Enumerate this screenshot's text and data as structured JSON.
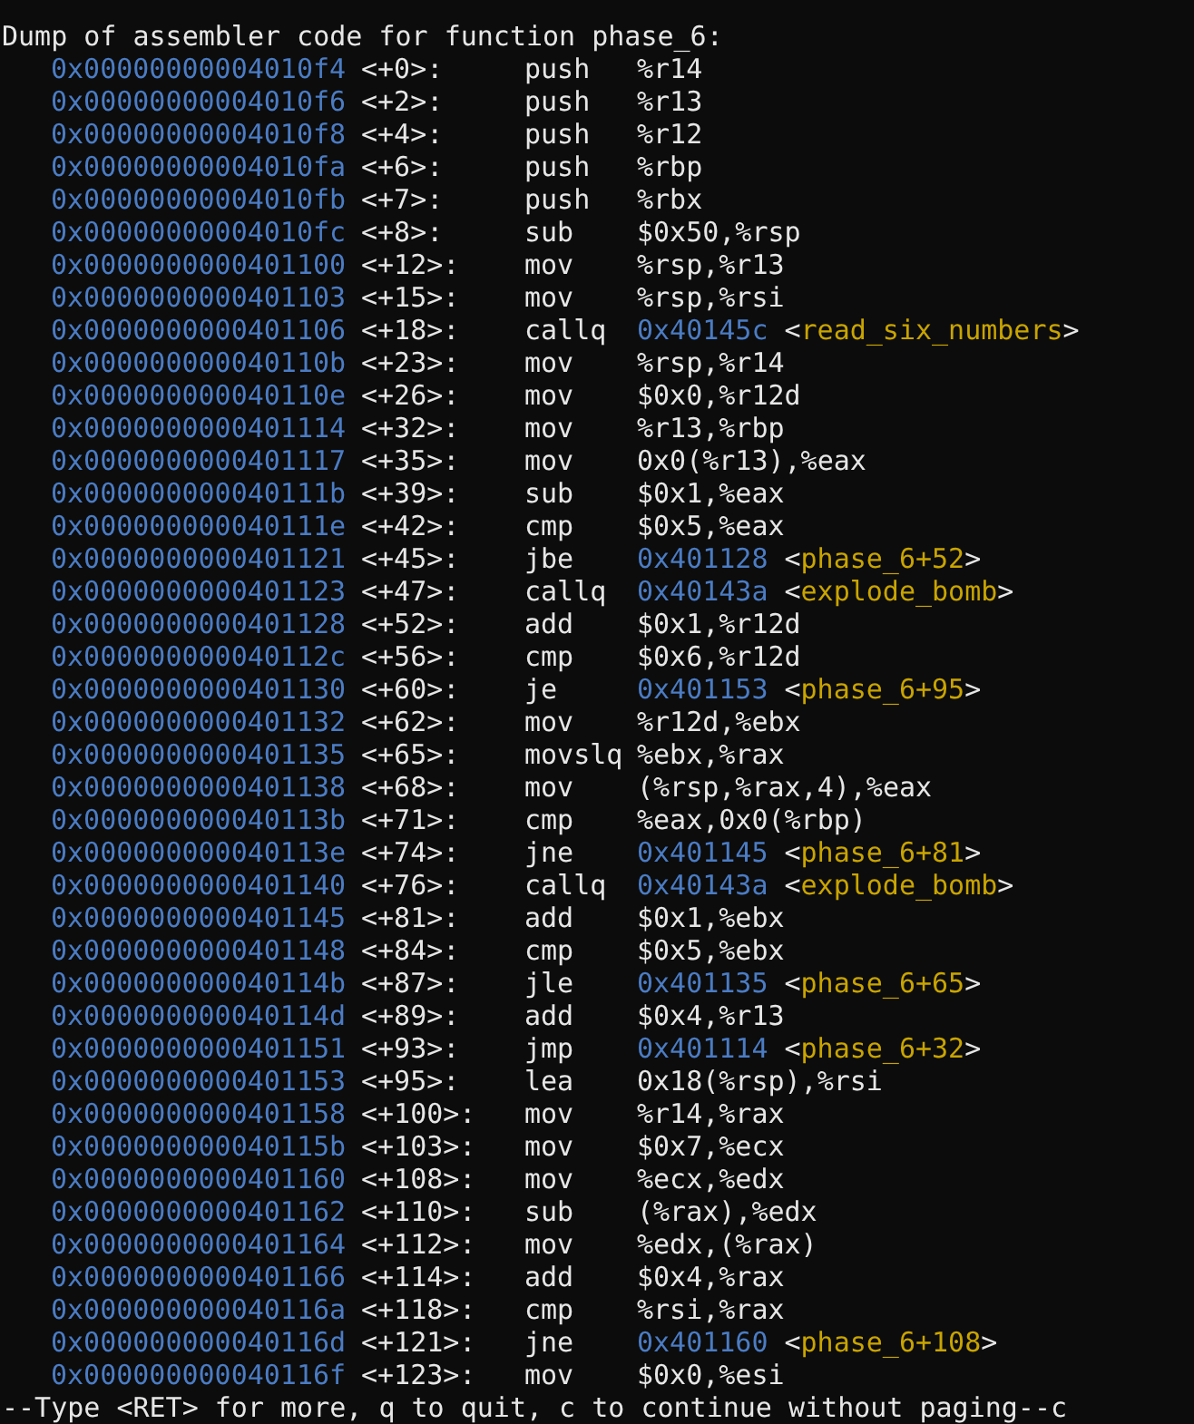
{
  "header": "Dump of assembler code for function phase_6:",
  "lines": [
    {
      "address": "0x00000000004010f4",
      "offset": "<+0>:",
      "mnemonic": "push",
      "operands": "%r14"
    },
    {
      "address": "0x00000000004010f6",
      "offset": "<+2>:",
      "mnemonic": "push",
      "operands": "%r13"
    },
    {
      "address": "0x00000000004010f8",
      "offset": "<+4>:",
      "mnemonic": "push",
      "operands": "%r12"
    },
    {
      "address": "0x00000000004010fa",
      "offset": "<+6>:",
      "mnemonic": "push",
      "operands": "%rbp"
    },
    {
      "address": "0x00000000004010fb",
      "offset": "<+7>:",
      "mnemonic": "push",
      "operands": "%rbx"
    },
    {
      "address": "0x00000000004010fc",
      "offset": "<+8>:",
      "mnemonic": "sub",
      "operands": "$0x50,%rsp"
    },
    {
      "address": "0x0000000000401100",
      "offset": "<+12>:",
      "mnemonic": "mov",
      "operands": "%rsp,%r13"
    },
    {
      "address": "0x0000000000401103",
      "offset": "<+15>:",
      "mnemonic": "mov",
      "operands": "%rsp,%rsi"
    },
    {
      "address": "0x0000000000401106",
      "offset": "<+18>:",
      "mnemonic": "callq",
      "target": "0x40145c",
      "symbol": "<read_six_numbers>"
    },
    {
      "address": "0x000000000040110b",
      "offset": "<+23>:",
      "mnemonic": "mov",
      "operands": "%rsp,%r14"
    },
    {
      "address": "0x000000000040110e",
      "offset": "<+26>:",
      "mnemonic": "mov",
      "operands": "$0x0,%r12d"
    },
    {
      "address": "0x0000000000401114",
      "offset": "<+32>:",
      "mnemonic": "mov",
      "operands": "%r13,%rbp"
    },
    {
      "address": "0x0000000000401117",
      "offset": "<+35>:",
      "mnemonic": "mov",
      "operands": "0x0(%r13),%eax"
    },
    {
      "address": "0x000000000040111b",
      "offset": "<+39>:",
      "mnemonic": "sub",
      "operands": "$0x1,%eax"
    },
    {
      "address": "0x000000000040111e",
      "offset": "<+42>:",
      "mnemonic": "cmp",
      "operands": "$0x5,%eax"
    },
    {
      "address": "0x0000000000401121",
      "offset": "<+45>:",
      "mnemonic": "jbe",
      "target": "0x401128",
      "symbol": "<phase_6+52>"
    },
    {
      "address": "0x0000000000401123",
      "offset": "<+47>:",
      "mnemonic": "callq",
      "target": "0x40143a",
      "symbol": "<explode_bomb>"
    },
    {
      "address": "0x0000000000401128",
      "offset": "<+52>:",
      "mnemonic": "add",
      "operands": "$0x1,%r12d"
    },
    {
      "address": "0x000000000040112c",
      "offset": "<+56>:",
      "mnemonic": "cmp",
      "operands": "$0x6,%r12d"
    },
    {
      "address": "0x0000000000401130",
      "offset": "<+60>:",
      "mnemonic": "je",
      "target": "0x401153",
      "symbol": "<phase_6+95>"
    },
    {
      "address": "0x0000000000401132",
      "offset": "<+62>:",
      "mnemonic": "mov",
      "operands": "%r12d,%ebx"
    },
    {
      "address": "0x0000000000401135",
      "offset": "<+65>:",
      "mnemonic": "movslq",
      "operands": "%ebx,%rax"
    },
    {
      "address": "0x0000000000401138",
      "offset": "<+68>:",
      "mnemonic": "mov",
      "operands": "(%rsp,%rax,4),%eax"
    },
    {
      "address": "0x000000000040113b",
      "offset": "<+71>:",
      "mnemonic": "cmp",
      "operands": "%eax,0x0(%rbp)"
    },
    {
      "address": "0x000000000040113e",
      "offset": "<+74>:",
      "mnemonic": "jne",
      "target": "0x401145",
      "symbol": "<phase_6+81>"
    },
    {
      "address": "0x0000000000401140",
      "offset": "<+76>:",
      "mnemonic": "callq",
      "target": "0x40143a",
      "symbol": "<explode_bomb>"
    },
    {
      "address": "0x0000000000401145",
      "offset": "<+81>:",
      "mnemonic": "add",
      "operands": "$0x1,%ebx"
    },
    {
      "address": "0x0000000000401148",
      "offset": "<+84>:",
      "mnemonic": "cmp",
      "operands": "$0x5,%ebx"
    },
    {
      "address": "0x000000000040114b",
      "offset": "<+87>:",
      "mnemonic": "jle",
      "target": "0x401135",
      "symbol": "<phase_6+65>"
    },
    {
      "address": "0x000000000040114d",
      "offset": "<+89>:",
      "mnemonic": "add",
      "operands": "$0x4,%r13"
    },
    {
      "address": "0x0000000000401151",
      "offset": "<+93>:",
      "mnemonic": "jmp",
      "target": "0x401114",
      "symbol": "<phase_6+32>"
    },
    {
      "address": "0x0000000000401153",
      "offset": "<+95>:",
      "mnemonic": "lea",
      "operands": "0x18(%rsp),%rsi"
    },
    {
      "address": "0x0000000000401158",
      "offset": "<+100>:",
      "mnemonic": "mov",
      "operands": "%r14,%rax"
    },
    {
      "address": "0x000000000040115b",
      "offset": "<+103>:",
      "mnemonic": "mov",
      "operands": "$0x7,%ecx"
    },
    {
      "address": "0x0000000000401160",
      "offset": "<+108>:",
      "mnemonic": "mov",
      "operands": "%ecx,%edx"
    },
    {
      "address": "0x0000000000401162",
      "offset": "<+110>:",
      "mnemonic": "sub",
      "operands": "(%rax),%edx"
    },
    {
      "address": "0x0000000000401164",
      "offset": "<+112>:",
      "mnemonic": "mov",
      "operands": "%edx,(%rax)"
    },
    {
      "address": "0x0000000000401166",
      "offset": "<+114>:",
      "mnemonic": "add",
      "operands": "$0x4,%rax"
    },
    {
      "address": "0x000000000040116a",
      "offset": "<+118>:",
      "mnemonic": "cmp",
      "operands": "%rsi,%rax"
    },
    {
      "address": "0x000000000040116d",
      "offset": "<+121>:",
      "mnemonic": "jne",
      "target": "0x401160",
      "symbol": "<phase_6+108>"
    },
    {
      "address": "0x000000000040116f",
      "offset": "<+123>:",
      "mnemonic": "mov",
      "operands": "$0x0,%esi"
    }
  ],
  "pager_prompt": "--Type <RET> for more, q to quit, c to continue without paging--c"
}
